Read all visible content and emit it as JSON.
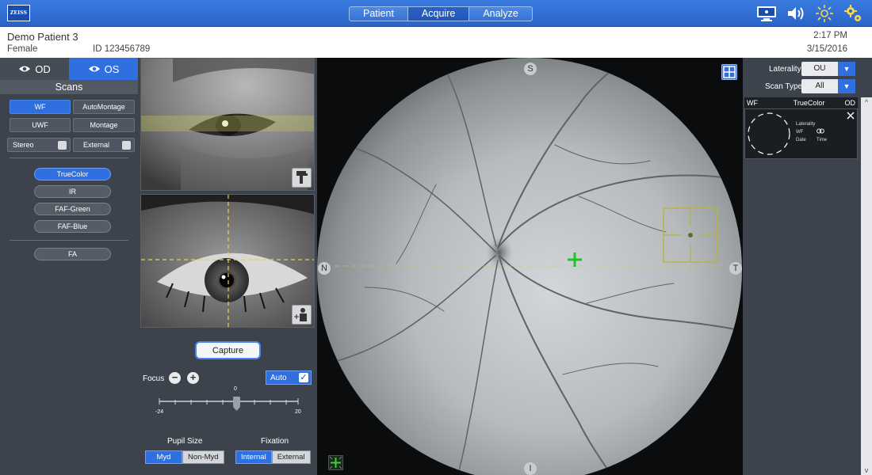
{
  "app": {
    "logo_text": "ZEISS",
    "nav_tabs": [
      "Patient",
      "Acquire",
      "Analyze"
    ],
    "active_tab": "Acquire",
    "icons": [
      "monitor-icon",
      "speaker-icon",
      "brightness-icon",
      "settings-icon"
    ]
  },
  "patient": {
    "name": "Demo Patient 3",
    "sex": "Female",
    "id": "ID 123456789",
    "time": "2:17 PM",
    "date": "3/15/2016"
  },
  "left_panel": {
    "eye_tabs": [
      "OD",
      "OS"
    ],
    "active_eye": "OS",
    "scans_title": "Scans",
    "scan_modes": [
      "WF",
      "AutoMontage",
      "UWF",
      "Montage"
    ],
    "selected_mode": "WF",
    "options": [
      "Stereo",
      "External"
    ],
    "filters": [
      "TrueColor",
      "IR",
      "FAF-Green",
      "FAF-Blue"
    ],
    "selected_filter": "TrueColor",
    "extra": [
      "FA"
    ]
  },
  "camera_panel": {
    "capture_label": "Capture",
    "focus_label": "Focus",
    "auto_label": "Auto",
    "auto_checked": true,
    "focus_value": "0",
    "focus_min": "-24",
    "focus_max": "20",
    "pupil_label": "Pupil Size",
    "pupil_options": [
      "Myd",
      "Non-Myd"
    ],
    "pupil_selected": "Myd",
    "fixation_label": "Fixation",
    "fixation_options": [
      "Internal",
      "External"
    ],
    "fixation_selected": "Internal"
  },
  "fundus": {
    "orientation": {
      "top": "S",
      "bottom": "I",
      "left": "N",
      "right": "T"
    }
  },
  "right_panel": {
    "laterality_label": "Laterality",
    "laterality_value": "OU",
    "scantype_label": "Scan Type",
    "scantype_value": "All",
    "thumb_header": {
      "mode": "WF",
      "filter": "TrueColor",
      "eye": "OD"
    },
    "thumb_info": {
      "laterality": "Laterality",
      "mode": "WF",
      "date": "Date",
      "time": "Time"
    }
  },
  "colors": {
    "accent_blue": "#2f6fe0",
    "panel_bg": "#3c434c",
    "fixation_green": "#22c12a"
  }
}
